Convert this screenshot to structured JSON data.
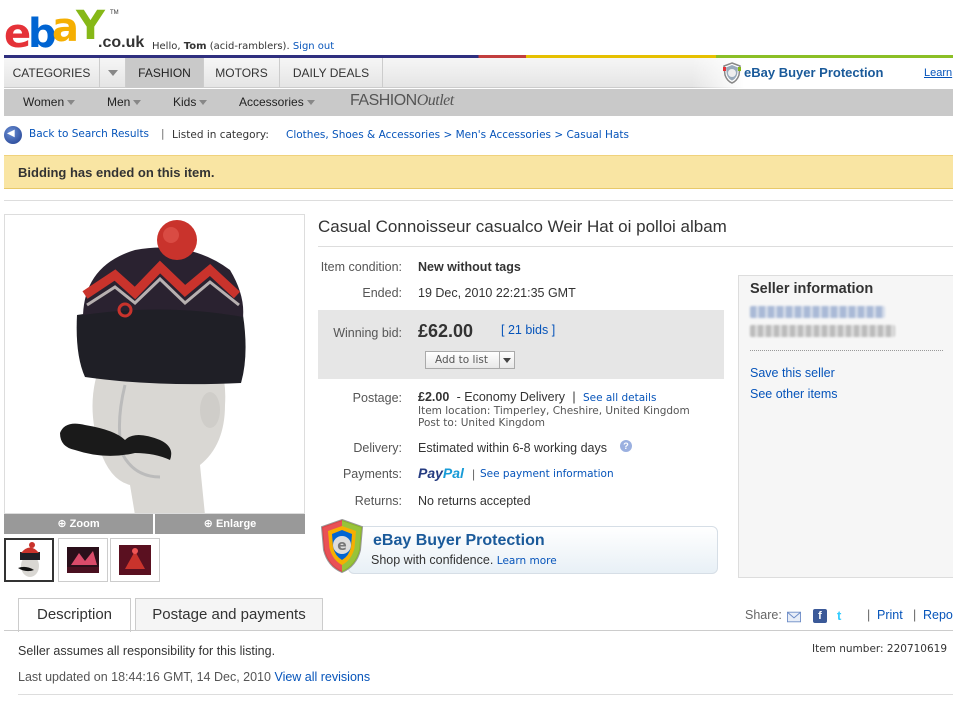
{
  "header": {
    "logo_text": "ebay",
    "logo_tld": ".co.uk",
    "greeting_prefix": "Hello, ",
    "user_name": "Tom",
    "user_handle": "(acid-ramblers).",
    "sign_out": "Sign out"
  },
  "nav": {
    "tabs": [
      "CATEGORIES",
      "FASHION",
      "MOTORS",
      "DAILY DEALS"
    ],
    "active_tab": "FASHION",
    "buyer_protection": "eBay Buyer Protection",
    "learn": "Learn"
  },
  "subnav": {
    "items": [
      "Women",
      "Men",
      "Kids",
      "Accessories"
    ],
    "outlet_a": "FASHION",
    "outlet_b": "Outlet"
  },
  "breadcrumb": {
    "back": "Back to Search Results",
    "separator": "|",
    "listed_in": "Listed in category:",
    "path": "Clothes, Shoes & Accessories > Men's Accessories > Casual Hats"
  },
  "banner": {
    "text": "Bidding has ended on this item."
  },
  "item": {
    "title": "Casual Connoisseur casualco Weir Hat oi polloi albam",
    "condition_label": "Item condition:",
    "condition": "New without tags",
    "ended_label": "Ended:",
    "ended": "19 Dec, 2010 22:21:35 GMT",
    "winning_label": "Winning bid:",
    "winning_bid": "£62.00",
    "bids": "[ 21 bids ]",
    "add_to_list": "Add to list",
    "postage_label": "Postage:",
    "postage_price": "£2.00",
    "postage_service": "- Economy Delivery",
    "postage_sep": "|",
    "see_all": "See all details",
    "item_location": "Item location: Timperley, Cheshire, United Kingdom",
    "post_to": "Post to: United Kingdom",
    "delivery_label": "Delivery:",
    "delivery": "Estimated within 6-8 working days",
    "payments_label": "Payments:",
    "paypal_a": "Pay",
    "paypal_b": "Pal",
    "payments_sep": "|",
    "see_payment": "See payment information",
    "returns_label": "Returns:",
    "returns": "No returns accepted"
  },
  "image": {
    "zoom": "Zoom",
    "enlarge": "Enlarge"
  },
  "buyer_protection_box": {
    "title": "eBay Buyer Protection",
    "subtitle": "Shop with confidence.",
    "learn_more": "Learn more"
  },
  "seller": {
    "title": "Seller information",
    "save": "Save this seller",
    "see_other": "See other items"
  },
  "tabs": [
    "Description",
    "Postage and payments"
  ],
  "share": {
    "label": "Share:",
    "print": "Print",
    "report": "Report"
  },
  "description": {
    "item_number": "Item number: 220710619",
    "responsibility": "Seller assumes all responsibility for this listing.",
    "updated_prefix": "Last updated on  18:44:16 GMT, 14 Dec, 2010",
    "revisions": "View all revisions"
  },
  "colors": {
    "link": "#0654ba",
    "banner_bg": "#f9e5a3",
    "ebay_e": "#e53238",
    "ebay_b": "#0064d2",
    "ebay_a": "#f5af02",
    "ebay_y": "#86b817"
  }
}
